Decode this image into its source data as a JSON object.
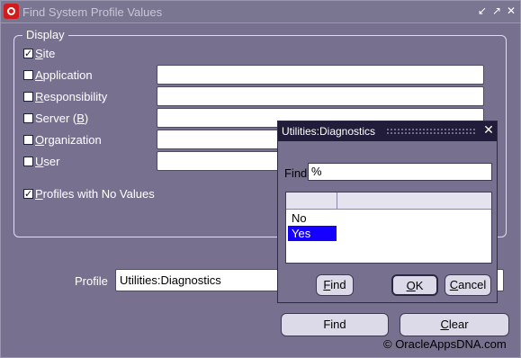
{
  "window": {
    "title": "Find System Profile Values",
    "controls": {
      "minimize": "minimize-icon",
      "maximize": "maximize-icon",
      "close": "close-icon"
    }
  },
  "display": {
    "group_label": "Display",
    "options": [
      {
        "label": "Site",
        "checked": true
      },
      {
        "label": "Application",
        "checked": false
      },
      {
        "label": "Responsibility",
        "checked": false
      },
      {
        "label": "Server (B)",
        "checked": false
      },
      {
        "label": "Organization",
        "checked": false
      },
      {
        "label": "User",
        "checked": false
      }
    ],
    "profiles_no_values": {
      "label": "Profiles with No Values",
      "checked": true
    }
  },
  "profile": {
    "label": "Profile",
    "value": "Utilities:Diagnostics"
  },
  "buttons": {
    "find": "Find",
    "clear": "Clear"
  },
  "watermark": "© OracleAppsDNA.com",
  "dialog": {
    "title": "Utilities:Diagnostics",
    "find_label": "Find",
    "find_value": "%",
    "list_items": [
      "No",
      "Yes"
    ],
    "selected_index": 1,
    "buttons": {
      "find": "Find",
      "ok": "OK",
      "cancel": "Cancel"
    }
  },
  "colors": {
    "background": "#77718f",
    "selection": "#1500ff",
    "app_icon": "#d21b1b"
  }
}
